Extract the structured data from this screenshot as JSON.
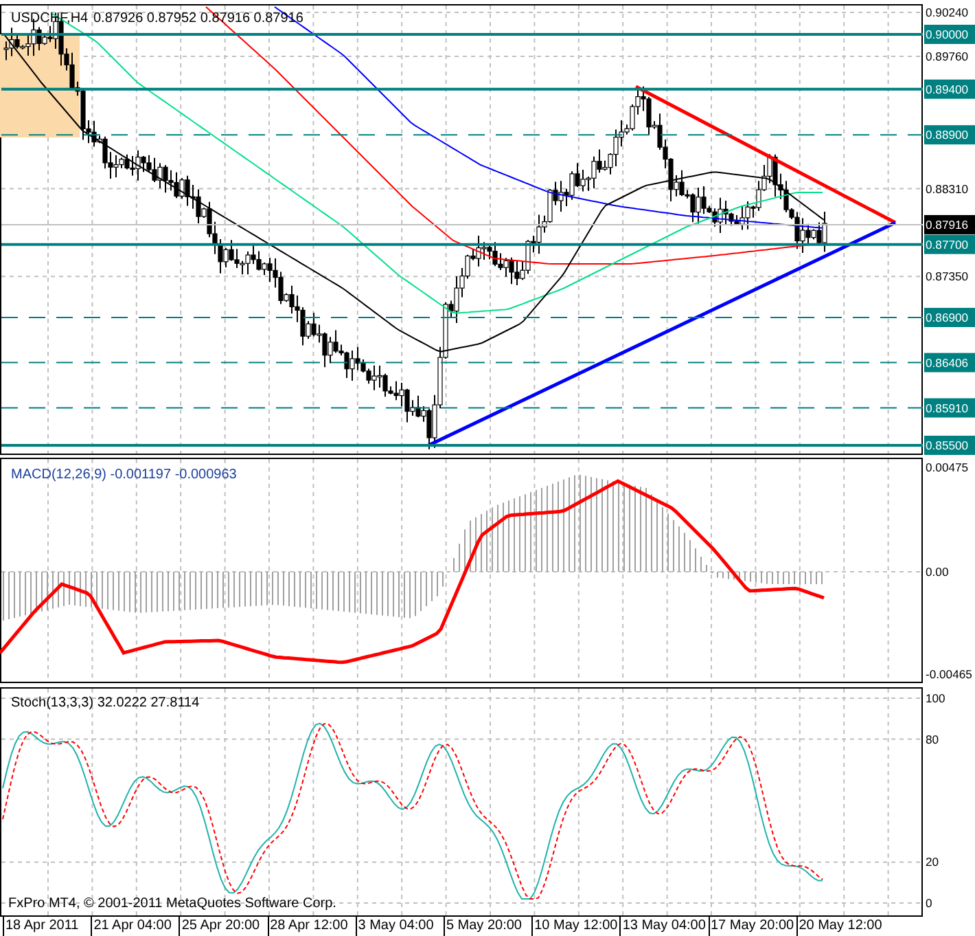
{
  "main_chart": {
    "title": "USDCHF,H4",
    "quote": "0.87926 0.87952 0.87916 0.87916",
    "price_ticks": [
      "0.90240",
      "0.89760",
      "0.88310",
      "0.87350"
    ],
    "levels": [
      {
        "label": "0.90000",
        "kind": "solid"
      },
      {
        "label": "0.89400",
        "kind": "solid"
      },
      {
        "label": "0.88900",
        "kind": "dashed"
      },
      {
        "label": "0.87700",
        "kind": "solid"
      },
      {
        "label": "0.86900",
        "kind": "dashed"
      },
      {
        "label": "0.86406",
        "kind": "dashed"
      },
      {
        "label": "0.85910",
        "kind": "dashed"
      },
      {
        "label": "0.85500",
        "kind": "solid"
      }
    ],
    "current_price": "0.87916"
  },
  "macd": {
    "title": "MACD(12,26,9) -0.001197 -0.000963",
    "ticks": [
      "0.00475",
      "0.00",
      "-0.00465"
    ]
  },
  "stoch": {
    "title": "Stoch(13,3,3) 32.0222 27.8114",
    "ticks": [
      "100",
      "80",
      "20",
      "0"
    ],
    "copyright": "FxPro MT4, © 2001-2011 MetaQuotes Software Corp."
  },
  "time_axis": [
    "18 Apr 2011",
    "21 Apr 04:00",
    "25 Apr 20:00",
    "28 Apr 12:00",
    "3 May 04:00",
    "5 May 20:00",
    "10 May 12:00",
    "13 May 04:00",
    "17 May 20:00",
    "20 May 12:00"
  ]
}
